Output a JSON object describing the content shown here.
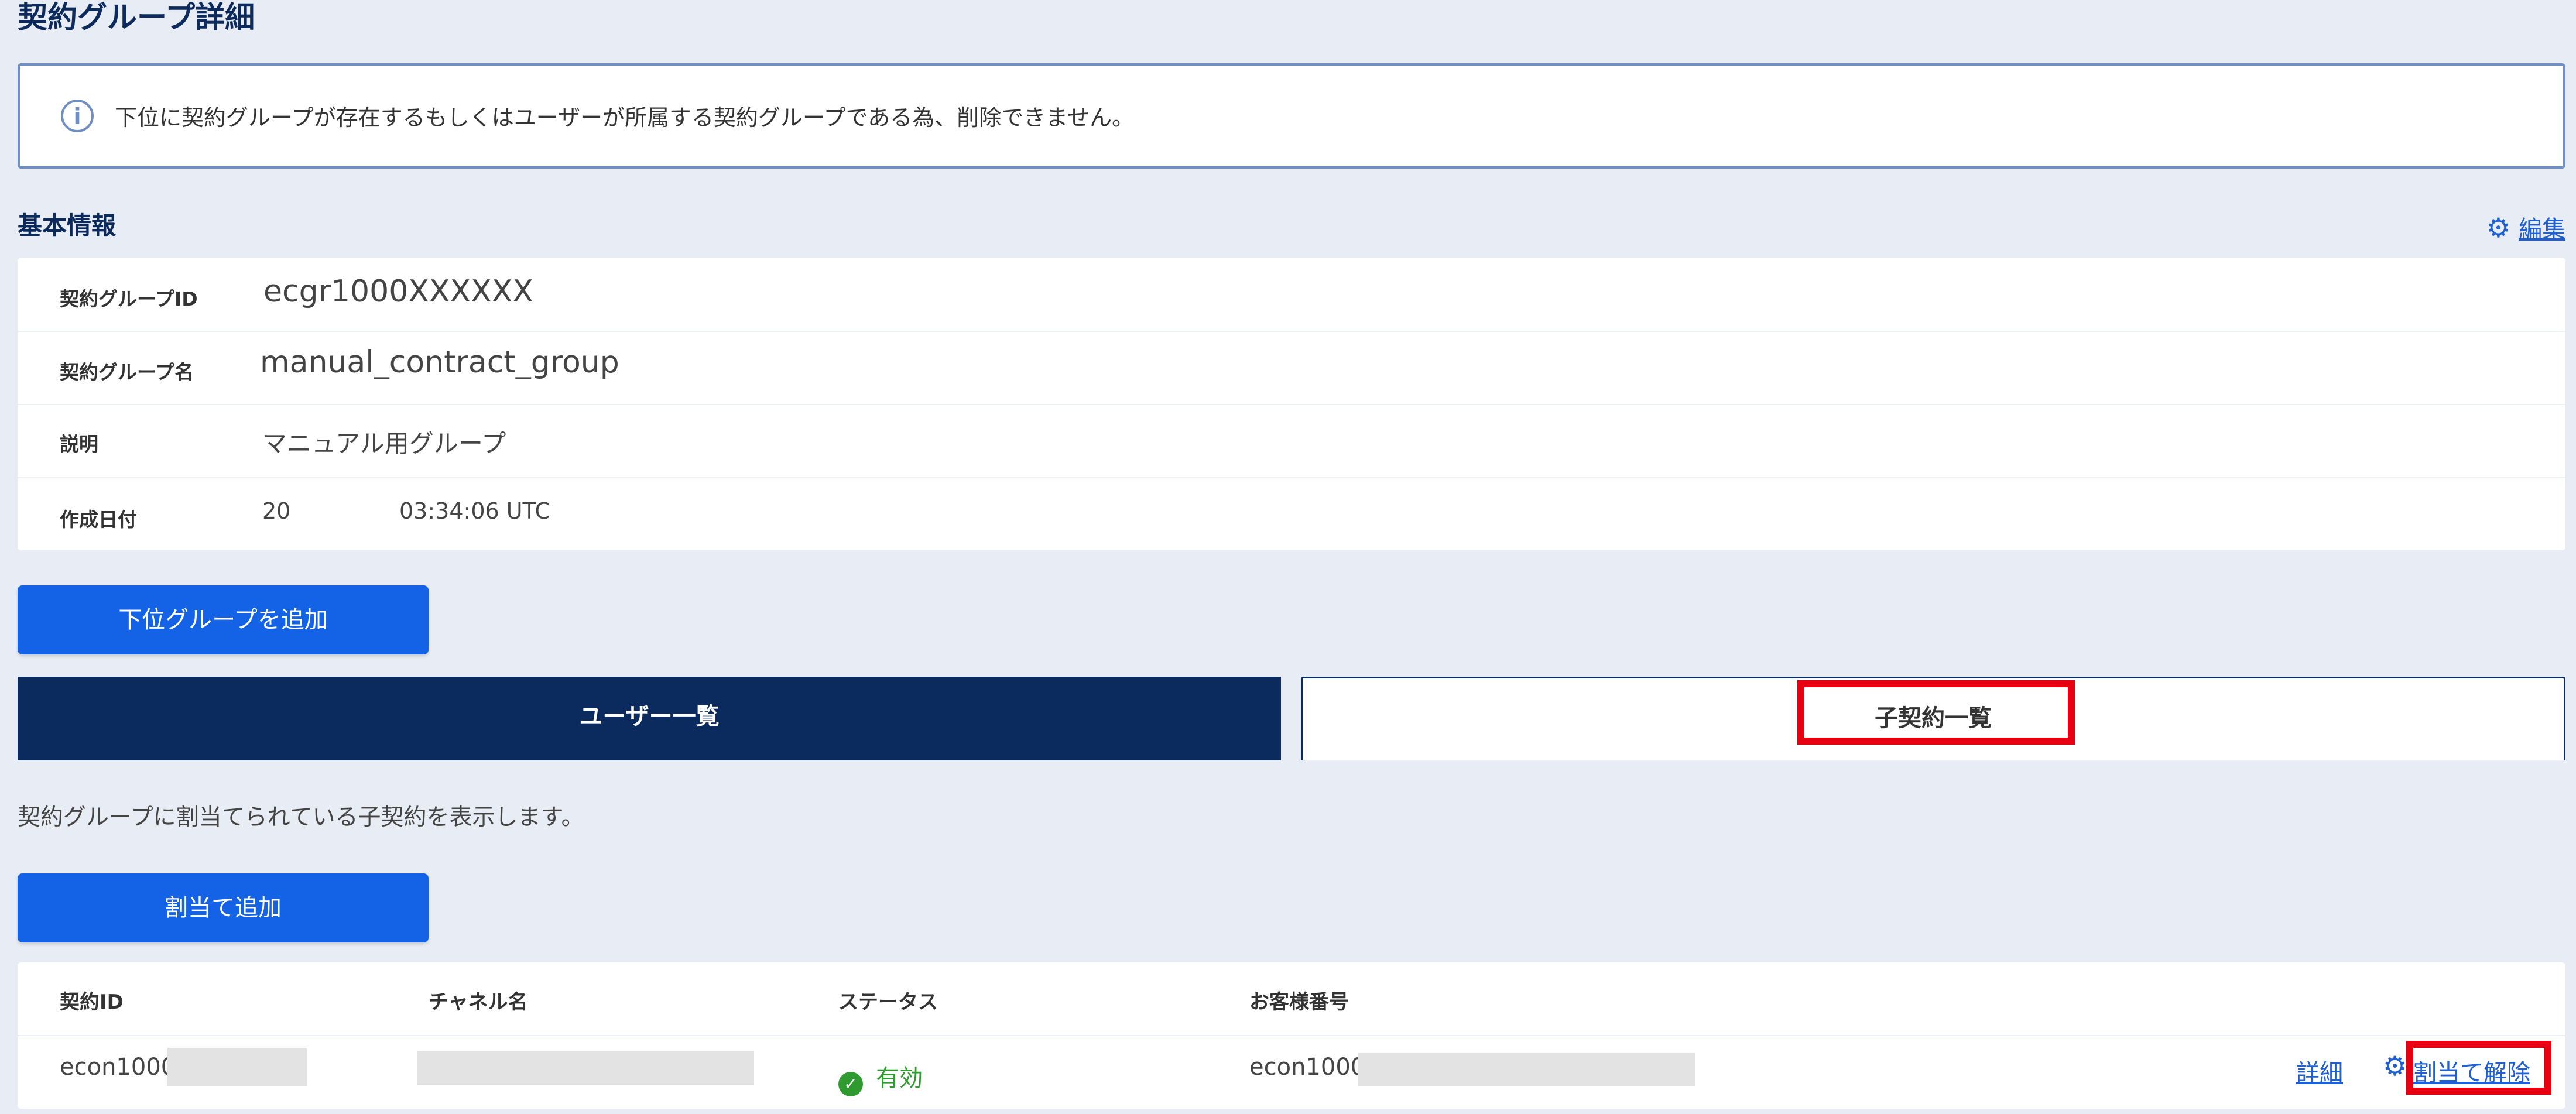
{
  "page": {
    "title": "契約グループ詳細"
  },
  "notice": {
    "icon": "info-icon",
    "text": "下位に契約グループが存在するもしくはユーザーが所属する契約グループである為、削除できません。"
  },
  "basic_info": {
    "title": "基本情報",
    "edit_label": "編集",
    "rows": [
      {
        "label": "契約グループID",
        "value": "ecgr1000XXXXXX"
      },
      {
        "label": "契約グループ名",
        "value": "manual_contract_group"
      },
      {
        "label": "説明",
        "value": "マニュアル用グループ"
      },
      {
        "label": "作成日付",
        "value_date": "20",
        "value_time": "03:34:06 UTC"
      }
    ]
  },
  "buttons": {
    "add_subgroup": "下位グループを追加",
    "add_assignment": "割当て追加"
  },
  "tabs": {
    "users": "ユーザー一覧",
    "child_contracts": "子契約一覧"
  },
  "child_contracts": {
    "description": "契約グループに割当てられている子契約を表示します。",
    "columns": [
      "契約ID",
      "チャネル名",
      "ステータス",
      "お客様番号"
    ],
    "rows": [
      {
        "contract_id": "econ1000",
        "channel_name": "",
        "status": "有効",
        "customer_number": "econ1000",
        "detail_link": "詳細",
        "unassign_link": "割当て解除"
      }
    ]
  },
  "colors": {
    "primary": "#1463e6",
    "navy": "#0b2a5e",
    "link": "#1e5fd6",
    "status_active": "#2f9a2f",
    "highlight": "#e60012"
  }
}
